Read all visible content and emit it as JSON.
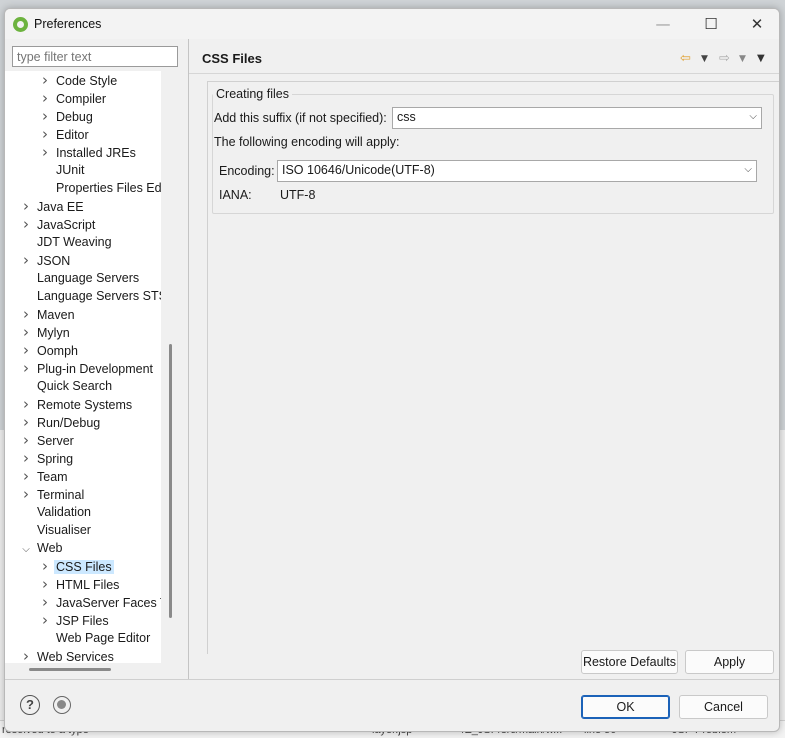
{
  "window": {
    "title": "Preferences",
    "minimize": "—",
    "maximize": "☐",
    "close": "✕"
  },
  "filter": {
    "placeholder": "type filter text"
  },
  "tree": {
    "items": [
      {
        "label": "Code Style",
        "level": 1,
        "expandable": true
      },
      {
        "label": "Compiler",
        "level": 1,
        "expandable": true
      },
      {
        "label": "Debug",
        "level": 1,
        "expandable": true
      },
      {
        "label": "Editor",
        "level": 1,
        "expandable": true
      },
      {
        "label": "Installed JREs",
        "level": 1,
        "expandable": true
      },
      {
        "label": "JUnit",
        "level": 1,
        "expandable": false
      },
      {
        "label": "Properties Files Edito",
        "level": 1,
        "expandable": false
      },
      {
        "label": "Java EE",
        "level": 0,
        "expandable": true
      },
      {
        "label": "JavaScript",
        "level": 0,
        "expandable": true
      },
      {
        "label": "JDT Weaving",
        "level": 0,
        "expandable": false
      },
      {
        "label": "JSON",
        "level": 0,
        "expandable": true
      },
      {
        "label": "Language Servers",
        "level": 0,
        "expandable": false
      },
      {
        "label": "Language Servers STS",
        "level": 0,
        "expandable": false
      },
      {
        "label": "Maven",
        "level": 0,
        "expandable": true
      },
      {
        "label": "Mylyn",
        "level": 0,
        "expandable": true
      },
      {
        "label": "Oomph",
        "level": 0,
        "expandable": true
      },
      {
        "label": "Plug-in Development",
        "level": 0,
        "expandable": true
      },
      {
        "label": "Quick Search",
        "level": 0,
        "expandable": false
      },
      {
        "label": "Remote Systems",
        "level": 0,
        "expandable": true
      },
      {
        "label": "Run/Debug",
        "level": 0,
        "expandable": true
      },
      {
        "label": "Server",
        "level": 0,
        "expandable": true
      },
      {
        "label": "Spring",
        "level": 0,
        "expandable": true
      },
      {
        "label": "Team",
        "level": 0,
        "expandable": true
      },
      {
        "label": "Terminal",
        "level": 0,
        "expandable": true
      },
      {
        "label": "Validation",
        "level": 0,
        "expandable": false
      },
      {
        "label": "Visualiser",
        "level": 0,
        "expandable": false
      },
      {
        "label": "Web",
        "level": 0,
        "expandable": true,
        "expanded": true
      },
      {
        "label": "CSS Files",
        "level": 1,
        "expandable": true,
        "selected": true
      },
      {
        "label": "HTML Files",
        "level": 1,
        "expandable": true
      },
      {
        "label": "JavaServer Faces To",
        "level": 1,
        "expandable": true
      },
      {
        "label": "JSP Files",
        "level": 1,
        "expandable": true
      },
      {
        "label": "Web Page Editor",
        "level": 1,
        "expandable": false
      },
      {
        "label": "Web Services",
        "level": 0,
        "expandable": true
      }
    ]
  },
  "page": {
    "title": "CSS Files"
  },
  "nav": {
    "back": "⇦",
    "back_dd": "▼",
    "forward": "⇨",
    "forward_dd": "▼",
    "menu": "▼"
  },
  "creating_files": {
    "group_title": "Creating files",
    "suffix_label": "Add this suffix (if not specified):",
    "suffix_value": "css",
    "encoding_note": "The following encoding will apply:",
    "encoding_label": "Encoding:",
    "encoding_value": "ISO 10646/Unicode(UTF-8)",
    "iana_label": "IANA:",
    "iana_value": "UTF-8"
  },
  "buttons": {
    "restore_defaults": "Restore Defaults",
    "apply": "Apply",
    "ok": "OK",
    "cancel": "Cancel"
  },
  "background": {
    "text1": "resolved to a type",
    "text2": "layer.jsp",
    "text3": "/Z_JSP/src/main/w...",
    "text4": "line 50",
    "text5": "JSP Problem"
  }
}
